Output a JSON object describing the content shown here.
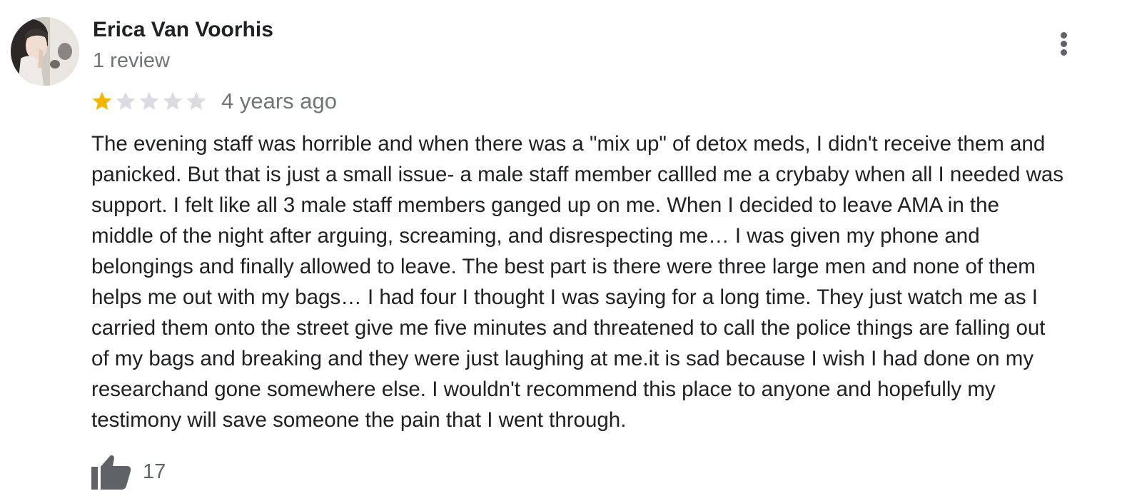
{
  "review": {
    "author": {
      "name": "Erica Van Voorhis",
      "review_count": "1 review",
      "avatar_icon": "profile-photo-avatar"
    },
    "menu_icon": "more-vertical-icon",
    "rating": 1,
    "rating_max": 5,
    "time_ago": "4 years ago",
    "text_lines": [
      "The evening staff was horrible and when there was a \"mix up\" of detox meds, I didn't  receive them and",
      "panicked. But that is just a small issue- a male staff member callled me a crybaby when all I needed was",
      "support. I felt like all 3 male staff members ganged up on me. When I decided to leave AMA in the",
      "middle of the night after arguing, screaming, and disrespecting me… I was given my phone and",
      "belongings and finally allowed to leave. The best part is there were three large men  and none of them",
      "helps me out with my bags… I had four I thought I was saying for a long time. They just watch me as I",
      "carried them onto the street give me five minutes and threatened to call the police things are falling out",
      "of my bags and breaking and they were just laughing at me.it is sad because I wish I had done on my",
      "researchand gone somewhere else. I wouldn't recommend this place to anyone and hopefully my",
      "testimony will save someone the pain that I went through."
    ],
    "like_icon": "thumbs-up-icon",
    "like_count": "17"
  },
  "colors": {
    "star_filled": "#f4b400",
    "star_empty": "#dadce0",
    "secondary_text": "#70757a",
    "icon": "#5f6368"
  }
}
